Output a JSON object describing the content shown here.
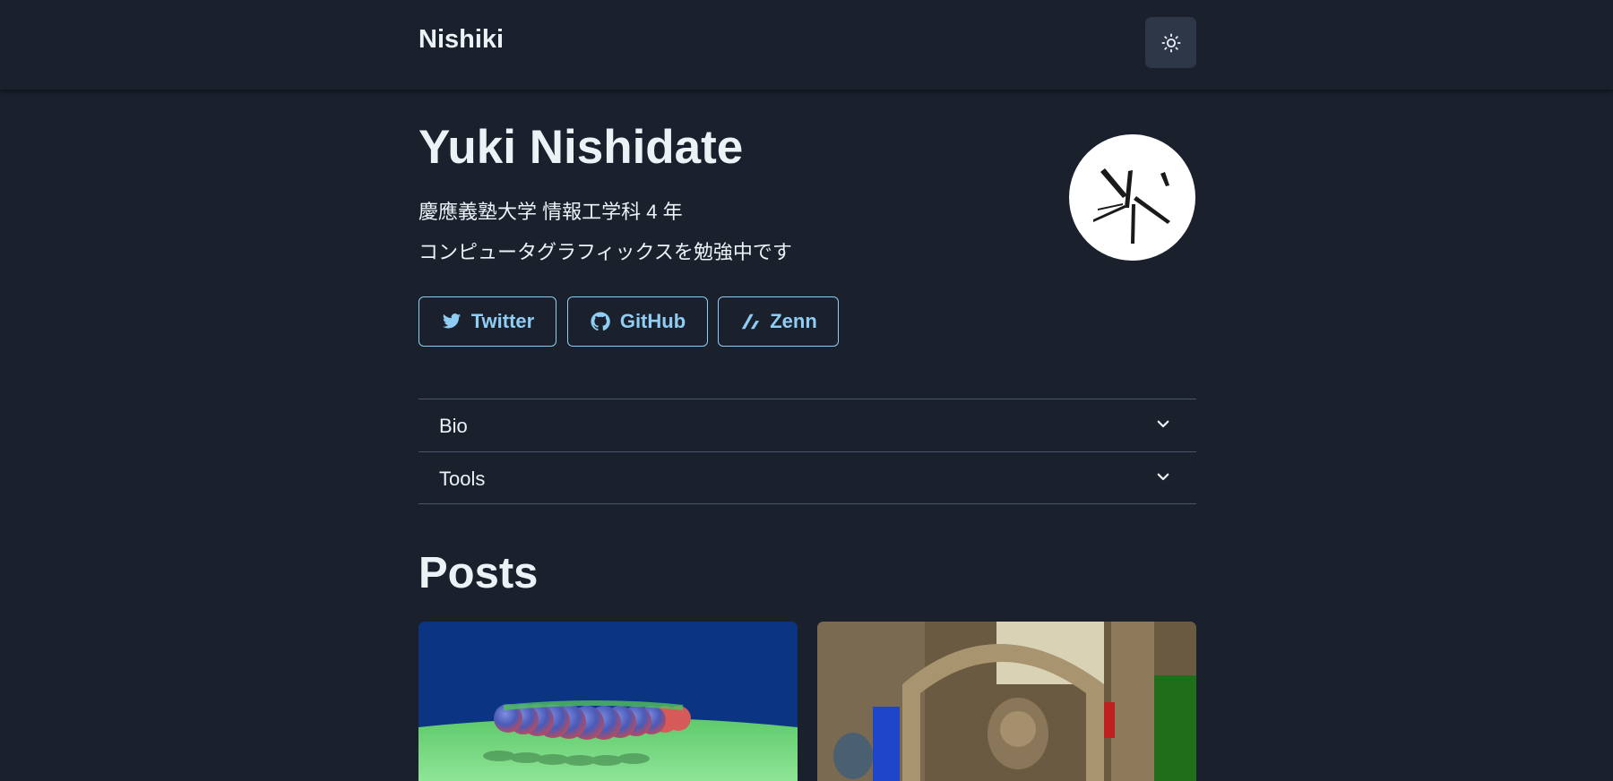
{
  "header": {
    "brand": "Nishiki",
    "theme_toggle_icon": "sun-icon"
  },
  "profile": {
    "name": "Yuki Nishidate",
    "affiliation": "慶應義塾大学 情報工学科 4 年",
    "tagline": "コンピュータグラフィックスを勉強中です",
    "avatar_icon": "abstract-logo"
  },
  "links": [
    {
      "label": "Twitter",
      "icon": "twitter-icon"
    },
    {
      "label": "GitHub",
      "icon": "github-icon"
    },
    {
      "label": "Zenn",
      "icon": "zenn-icon"
    }
  ],
  "accordion": [
    {
      "label": "Bio"
    },
    {
      "label": "Tools"
    }
  ],
  "posts": {
    "heading": "Posts"
  },
  "colors": {
    "background": "#1a202c",
    "text": "#edf2f7",
    "accent": "#90cdf4",
    "button_bg": "#2d3748",
    "divider": "#4a5568"
  }
}
